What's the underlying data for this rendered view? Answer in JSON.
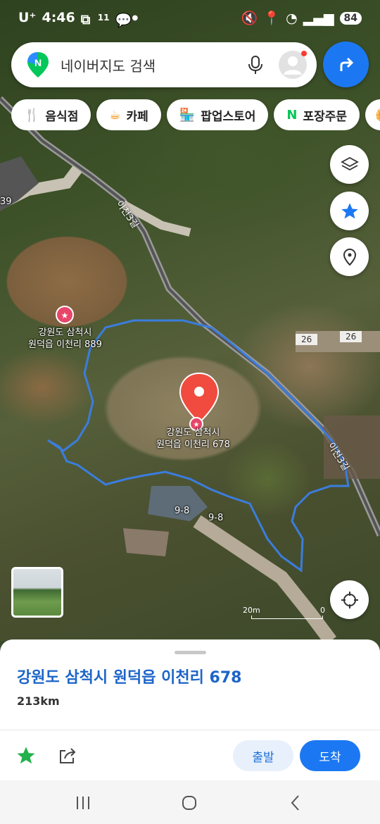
{
  "status": {
    "carrier": "U⁺",
    "time": "4:46",
    "notif_count": "11",
    "battery": "84"
  },
  "search": {
    "placeholder": "네이버지도 검색"
  },
  "chips": [
    {
      "icon": "fork-knife-icon",
      "label": "음식점"
    },
    {
      "icon": "coffee-cup-icon",
      "label": "카페"
    },
    {
      "icon": "store-icon",
      "label": "팝업스토어"
    },
    {
      "icon": "naver-n-icon",
      "label": "포장주문"
    }
  ],
  "map": {
    "road_label": "이천3길",
    "road_label_2": "이천3길",
    "poi_1": "강원도 삼척시\n원덕읍 이천리 889",
    "poi_main": "강원도 삼척시\n원덕읍 이천리 678",
    "addr_26a": "26",
    "addr_26b": "26",
    "addr_98a": "9-8",
    "addr_98b": "9-8",
    "edge_39": "39",
    "scale_start": "20m",
    "scale_end": "0"
  },
  "sheet": {
    "title": "강원도 삼척시 원덕읍 이천리 678",
    "distance": "213km",
    "start_label": "출발",
    "arrive_label": "도착"
  },
  "colors": {
    "accent": "#1b78f2",
    "title_blue": "#1c64c8",
    "route_line": "#3b7ddd",
    "marker_red": "#f04b3e"
  }
}
